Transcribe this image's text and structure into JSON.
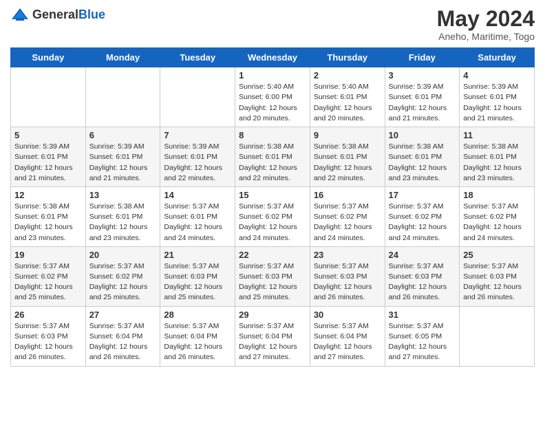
{
  "header": {
    "logo_general": "General",
    "logo_blue": "Blue",
    "month_year": "May 2024",
    "location": "Aneho, Maritime, Togo"
  },
  "weekdays": [
    "Sunday",
    "Monday",
    "Tuesday",
    "Wednesday",
    "Thursday",
    "Friday",
    "Saturday"
  ],
  "weeks": [
    [
      {
        "day": "",
        "info": ""
      },
      {
        "day": "",
        "info": ""
      },
      {
        "day": "",
        "info": ""
      },
      {
        "day": "1",
        "info": "Sunrise: 5:40 AM\nSunset: 6:00 PM\nDaylight: 12 hours\nand 20 minutes."
      },
      {
        "day": "2",
        "info": "Sunrise: 5:40 AM\nSunset: 6:01 PM\nDaylight: 12 hours\nand 20 minutes."
      },
      {
        "day": "3",
        "info": "Sunrise: 5:39 AM\nSunset: 6:01 PM\nDaylight: 12 hours\nand 21 minutes."
      },
      {
        "day": "4",
        "info": "Sunrise: 5:39 AM\nSunset: 6:01 PM\nDaylight: 12 hours\nand 21 minutes."
      }
    ],
    [
      {
        "day": "5",
        "info": "Sunrise: 5:39 AM\nSunset: 6:01 PM\nDaylight: 12 hours\nand 21 minutes."
      },
      {
        "day": "6",
        "info": "Sunrise: 5:39 AM\nSunset: 6:01 PM\nDaylight: 12 hours\nand 21 minutes."
      },
      {
        "day": "7",
        "info": "Sunrise: 5:39 AM\nSunset: 6:01 PM\nDaylight: 12 hours\nand 22 minutes."
      },
      {
        "day": "8",
        "info": "Sunrise: 5:38 AM\nSunset: 6:01 PM\nDaylight: 12 hours\nand 22 minutes."
      },
      {
        "day": "9",
        "info": "Sunrise: 5:38 AM\nSunset: 6:01 PM\nDaylight: 12 hours\nand 22 minutes."
      },
      {
        "day": "10",
        "info": "Sunrise: 5:38 AM\nSunset: 6:01 PM\nDaylight: 12 hours\nand 23 minutes."
      },
      {
        "day": "11",
        "info": "Sunrise: 5:38 AM\nSunset: 6:01 PM\nDaylight: 12 hours\nand 23 minutes."
      }
    ],
    [
      {
        "day": "12",
        "info": "Sunrise: 5:38 AM\nSunset: 6:01 PM\nDaylight: 12 hours\nand 23 minutes."
      },
      {
        "day": "13",
        "info": "Sunrise: 5:38 AM\nSunset: 6:01 PM\nDaylight: 12 hours\nand 23 minutes."
      },
      {
        "day": "14",
        "info": "Sunrise: 5:37 AM\nSunset: 6:01 PM\nDaylight: 12 hours\nand 24 minutes."
      },
      {
        "day": "15",
        "info": "Sunrise: 5:37 AM\nSunset: 6:02 PM\nDaylight: 12 hours\nand 24 minutes."
      },
      {
        "day": "16",
        "info": "Sunrise: 5:37 AM\nSunset: 6:02 PM\nDaylight: 12 hours\nand 24 minutes."
      },
      {
        "day": "17",
        "info": "Sunrise: 5:37 AM\nSunset: 6:02 PM\nDaylight: 12 hours\nand 24 minutes."
      },
      {
        "day": "18",
        "info": "Sunrise: 5:37 AM\nSunset: 6:02 PM\nDaylight: 12 hours\nand 24 minutes."
      }
    ],
    [
      {
        "day": "19",
        "info": "Sunrise: 5:37 AM\nSunset: 6:02 PM\nDaylight: 12 hours\nand 25 minutes."
      },
      {
        "day": "20",
        "info": "Sunrise: 5:37 AM\nSunset: 6:02 PM\nDaylight: 12 hours\nand 25 minutes."
      },
      {
        "day": "21",
        "info": "Sunrise: 5:37 AM\nSunset: 6:03 PM\nDaylight: 12 hours\nand 25 minutes."
      },
      {
        "day": "22",
        "info": "Sunrise: 5:37 AM\nSunset: 6:03 PM\nDaylight: 12 hours\nand 25 minutes."
      },
      {
        "day": "23",
        "info": "Sunrise: 5:37 AM\nSunset: 6:03 PM\nDaylight: 12 hours\nand 26 minutes."
      },
      {
        "day": "24",
        "info": "Sunrise: 5:37 AM\nSunset: 6:03 PM\nDaylight: 12 hours\nand 26 minutes."
      },
      {
        "day": "25",
        "info": "Sunrise: 5:37 AM\nSunset: 6:03 PM\nDaylight: 12 hours\nand 26 minutes."
      }
    ],
    [
      {
        "day": "26",
        "info": "Sunrise: 5:37 AM\nSunset: 6:03 PM\nDaylight: 12 hours\nand 26 minutes."
      },
      {
        "day": "27",
        "info": "Sunrise: 5:37 AM\nSunset: 6:04 PM\nDaylight: 12 hours\nand 26 minutes."
      },
      {
        "day": "28",
        "info": "Sunrise: 5:37 AM\nSunset: 6:04 PM\nDaylight: 12 hours\nand 26 minutes."
      },
      {
        "day": "29",
        "info": "Sunrise: 5:37 AM\nSunset: 6:04 PM\nDaylight: 12 hours\nand 27 minutes."
      },
      {
        "day": "30",
        "info": "Sunrise: 5:37 AM\nSunset: 6:04 PM\nDaylight: 12 hours\nand 27 minutes."
      },
      {
        "day": "31",
        "info": "Sunrise: 5:37 AM\nSunset: 6:05 PM\nDaylight: 12 hours\nand 27 minutes."
      },
      {
        "day": "",
        "info": ""
      }
    ]
  ]
}
